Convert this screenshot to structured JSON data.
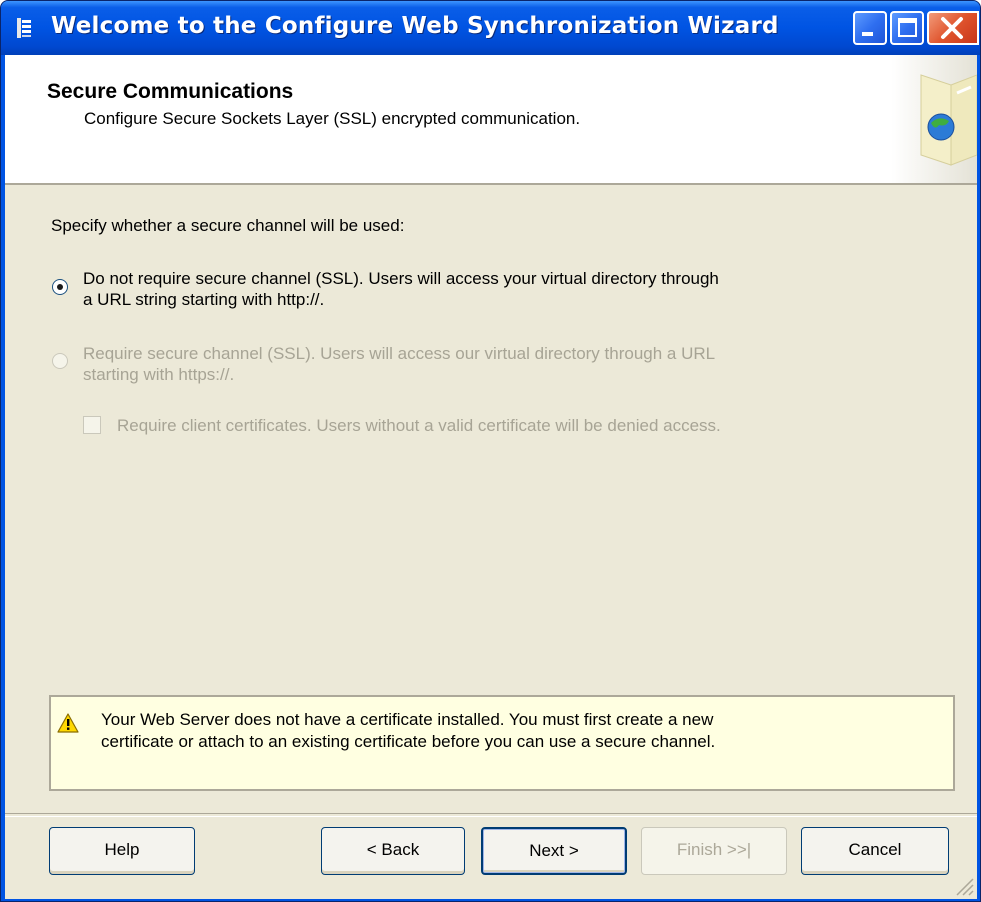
{
  "window": {
    "title": "Welcome to the Configure Web Synchronization Wizard",
    "icon": "wizard-app-icon",
    "controls": [
      "minimize-icon",
      "maximize-icon",
      "close-icon"
    ]
  },
  "header": {
    "title": "Secure Communications",
    "subtitle": "Configure Secure Sockets Layer (SSL) encrypted communication."
  },
  "main": {
    "prompt": "Specify whether a secure channel will be used:",
    "options": [
      {
        "line1": "Do not require secure channel (SSL). Users will access your virtual directory through",
        "line2": "a URL string starting with http://.",
        "checked": true,
        "enabled": true
      },
      {
        "line1": "Require secure channel (SSL).  Users will access our virtual directory through a URL",
        "line2": "starting with https://.",
        "checked": false,
        "enabled": false
      }
    ],
    "client_cert": {
      "label": "Require client certificates.  Users without a valid certificate will be denied access.",
      "checked": false,
      "enabled": false
    }
  },
  "warning": {
    "icon": "warning-icon",
    "line1": "Your Web Server does not have a certificate installed.  You must first create a new",
    "line2": "certificate or attach to an existing certificate before you can use a secure channel."
  },
  "buttons": {
    "help": "Help",
    "back": "< Back",
    "next": "Next >",
    "finish": "Finish >>|",
    "cancel": "Cancel"
  },
  "colors": {
    "titlebar": "#0054e3",
    "dialog_bg": "#ece9d8",
    "warning_bg": "#ffffe1"
  }
}
